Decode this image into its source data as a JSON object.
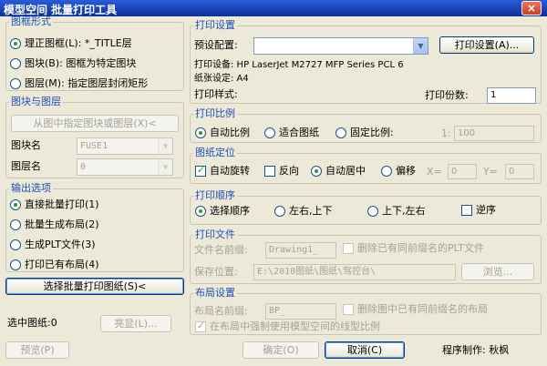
{
  "window": {
    "title": "模型空间  批量打印工具",
    "close_glyph": "×"
  },
  "frame_type": {
    "legend": "图框形式",
    "options": [
      {
        "label": "理正图框(L): *_TITLE层",
        "selected": true
      },
      {
        "label": "图块(B): 图框为特定图块",
        "selected": false
      },
      {
        "label": "图层(M): 指定图层封闭矩形",
        "selected": false
      }
    ]
  },
  "block_layer": {
    "legend": "图块与图层",
    "pick_button": "从图中指定图块或图层(X)<",
    "block_name_label": "图块名",
    "block_name_value": "FUSE1",
    "layer_name_label": "图层名",
    "layer_name_value": "0"
  },
  "output": {
    "legend": "输出选项",
    "options": [
      {
        "label": "直接批量打印(1)",
        "selected": true
      },
      {
        "label": "批量生成布局(2)",
        "selected": false
      },
      {
        "label": "生成PLT文件(3)",
        "selected": false
      },
      {
        "label": "打印已有布局(4)",
        "selected": false
      }
    ]
  },
  "select_button": "选择批量打印图纸(S)<",
  "selected_count_label": "选中图纸:0",
  "highlight_button": "亮显(L)...",
  "preview_button": "预览(P)",
  "print_settings": {
    "legend": "打印设置",
    "preset_label": "预设配置:",
    "preset_value": "",
    "settings_button": "打印设置(A)...",
    "device": "打印设备: HP LaserJet M2727 MFP Series PCL 6",
    "paper": "纸张设定: A4",
    "style_label": "打印样式:",
    "copies_label": "打印份数:",
    "copies_value": "1"
  },
  "scale": {
    "legend": "打印比例",
    "options": [
      {
        "label": "自动比例",
        "selected": true
      },
      {
        "label": "适合图纸",
        "selected": false
      },
      {
        "label": "固定比例:",
        "selected": false
      }
    ],
    "ratio_prefix": "1:",
    "ratio_value": "100"
  },
  "position": {
    "legend": "图纸定位",
    "auto_rotate": {
      "label": "自动旋转",
      "checked": true
    },
    "reverse": {
      "label": "反向",
      "checked": false
    },
    "center": {
      "label": "自动居中",
      "selected": true
    },
    "offset": {
      "label": "偏移",
      "selected": false
    },
    "x_label": "X=",
    "x_value": "0",
    "y_label": "Y=",
    "y_value": "0"
  },
  "order": {
    "legend": "打印顺序",
    "options": [
      {
        "label": "选择顺序",
        "selected": true
      },
      {
        "label": "左右,上下",
        "selected": false
      },
      {
        "label": "上下,左右",
        "selected": false
      }
    ],
    "reverse": {
      "label": "逆序",
      "checked": false
    }
  },
  "print_file": {
    "legend": "打印文件",
    "prefix_label": "文件名前缀:",
    "prefix_value": "Drawing1_",
    "delete_same": {
      "label": "删除已有同前缀名的PLT文件",
      "checked": false
    },
    "location_label": "保存位置:",
    "location_value": "E:\\2010图纸\\图纸\\驾控台\\",
    "browse_button": "浏览..."
  },
  "layout": {
    "legend": "布局设置",
    "prefix_label": "布局名前缀:",
    "prefix_value": "BP_",
    "delete_layout": {
      "label": "删除图中已有同前缀名的布局",
      "checked": false
    },
    "force_scale": {
      "label": "在布局中强制使用模型空间的线型比例",
      "checked": true
    }
  },
  "ok_button": "确定(O)",
  "cancel_button": "取消(C)",
  "author": "程序制作: 秋枫"
}
